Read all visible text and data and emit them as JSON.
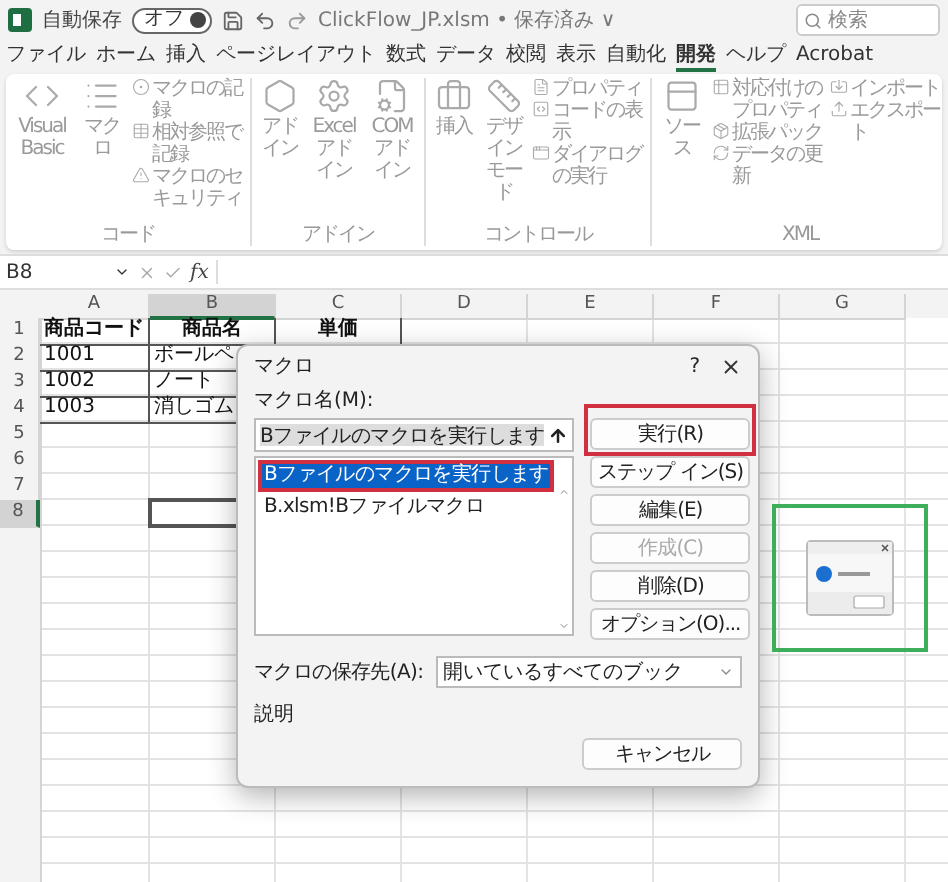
{
  "title_bar": {
    "autosave_label": "自動保存",
    "autosave_toggle": {
      "label": "オフ",
      "on": false
    },
    "document_title": "ClickFlow_JP.xlsm • 保存済み ∨",
    "search_placeholder": "検索"
  },
  "menu_tabs": [
    {
      "label": "ファイル",
      "selected": false
    },
    {
      "label": "ホーム",
      "selected": false
    },
    {
      "label": "挿入",
      "selected": false
    },
    {
      "label": "ページレイアウト",
      "selected": false
    },
    {
      "label": "数式",
      "selected": false
    },
    {
      "label": "データ",
      "selected": false
    },
    {
      "label": "校閲",
      "selected": false
    },
    {
      "label": "表示",
      "selected": false
    },
    {
      "label": "自動化",
      "selected": false
    },
    {
      "label": "開発",
      "selected": true
    },
    {
      "label": "ヘルプ",
      "selected": false
    },
    {
      "label": "Acrobat",
      "selected": false
    }
  ],
  "ribbon": {
    "disabled": true,
    "groups": [
      {
        "label": "コード",
        "items": [
          {
            "kind": "large",
            "label": "Visual Basic"
          },
          {
            "kind": "large",
            "label": "マクロ"
          },
          {
            "kind": "small",
            "label": "マクロの記録"
          },
          {
            "kind": "small",
            "label": "相対参照で記録"
          },
          {
            "kind": "small",
            "label": "マクロのセキュリティ"
          }
        ]
      },
      {
        "label": "アドイン",
        "items": [
          {
            "kind": "large",
            "label": "アドイン"
          },
          {
            "kind": "large",
            "label": "Excel アドイン"
          },
          {
            "kind": "large",
            "label": "COM アドイン"
          }
        ]
      },
      {
        "label": "コントロール",
        "items": [
          {
            "kind": "large",
            "label": "挿入"
          },
          {
            "kind": "large",
            "label": "デザインモード"
          },
          {
            "kind": "small",
            "label": "プロパティ"
          },
          {
            "kind": "small",
            "label": "コードの表示"
          },
          {
            "kind": "small",
            "label": "ダイアログの実行"
          }
        ]
      },
      {
        "label": "XML",
        "items": [
          {
            "kind": "large",
            "label": "ソース"
          },
          {
            "kind": "small",
            "label": "対応付けのプロパティ"
          },
          {
            "kind": "small",
            "label": "拡張パック"
          },
          {
            "kind": "small",
            "label": "データの更新"
          },
          {
            "kind": "small",
            "label": "インポート"
          },
          {
            "kind": "small",
            "label": "エクスポート"
          }
        ]
      }
    ]
  },
  "formula_bar": {
    "name_box": "B8",
    "function_label": "fx"
  },
  "sheet": {
    "columns": [
      {
        "label": "A",
        "selected": false
      },
      {
        "label": "B",
        "selected": true
      },
      {
        "label": "C",
        "selected": false
      },
      {
        "label": "D",
        "selected": false
      },
      {
        "label": "E",
        "selected": false
      },
      {
        "label": "F",
        "selected": false
      },
      {
        "label": "G",
        "selected": false
      }
    ],
    "rows": [
      {
        "number": "1",
        "selected": false,
        "header": true,
        "bordered": true,
        "cells": [
          "商品コード",
          "商品名",
          "単価"
        ]
      },
      {
        "number": "2",
        "selected": false,
        "header": false,
        "bordered": true,
        "cells": [
          "1001",
          "ボールペ"
        ]
      },
      {
        "number": "3",
        "selected": false,
        "header": false,
        "bordered": true,
        "cells": [
          "1002",
          "ノート"
        ]
      },
      {
        "number": "4",
        "selected": false,
        "header": false,
        "bordered": true,
        "cells": [
          "1003",
          "消しゴム"
        ]
      },
      {
        "number": "5",
        "selected": false
      },
      {
        "number": "6",
        "selected": false
      },
      {
        "number": "7",
        "selected": false
      },
      {
        "number": "8",
        "selected": true
      }
    ]
  },
  "dialog": {
    "title": "マクロ",
    "help": "?",
    "macro_name_label": "マクロ名(M):",
    "macro_name_value": "Bファイルのマクロを実行します",
    "macros": [
      {
        "text": "Bファイルのマクロを実行します",
        "selected": true,
        "highlighted": true
      },
      {
        "text": "B.xlsm!Bファイルマクロ",
        "selected": false,
        "highlighted": false
      }
    ],
    "buttons": [
      {
        "label": "実行(R)",
        "disabled": false,
        "highlighted": true
      },
      {
        "label": "ステップ イン(S)",
        "disabled": false,
        "highlighted": false
      },
      {
        "label": "編集(E)",
        "disabled": false,
        "highlighted": false
      },
      {
        "label": "作成(C)",
        "disabled": true,
        "highlighted": false
      },
      {
        "label": "削除(D)",
        "disabled": false,
        "highlighted": false
      },
      {
        "label": "オプション(O)...",
        "disabled": false,
        "highlighted": false
      }
    ],
    "location_label": "マクロの保存先(A):",
    "location_value": "開いているすべてのブック",
    "description_label": "説明",
    "cancel": "キャンセル"
  }
}
